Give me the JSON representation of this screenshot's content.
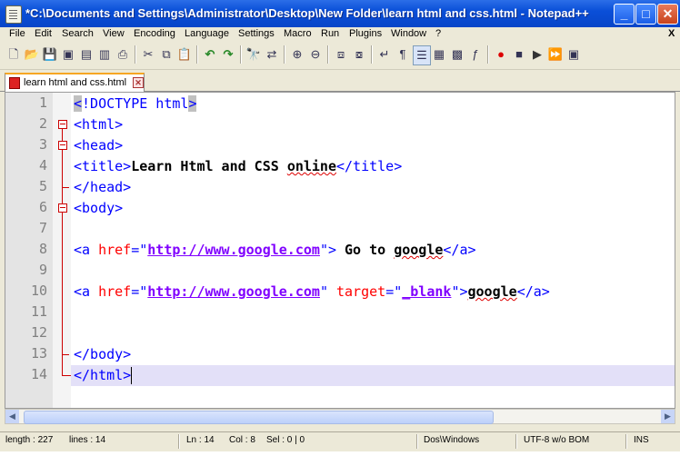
{
  "window": {
    "title": "*C:\\Documents and Settings\\Administrator\\Desktop\\New Folder\\learn html and css.html - Notepad++",
    "min_glyph": "_",
    "max_glyph": "□",
    "close_glyph": "✕"
  },
  "menu": [
    "File",
    "Edit",
    "Search",
    "View",
    "Encoding",
    "Language",
    "Settings",
    "Macro",
    "Run",
    "Plugins",
    "Window",
    "?"
  ],
  "menu_close": "X",
  "tab": {
    "label": "learn html and css.html",
    "close": "✕"
  },
  "line_numbers": [
    "1",
    "2",
    "3",
    "4",
    "5",
    "6",
    "7",
    "8",
    "9",
    "10",
    "11",
    "12",
    "13",
    "14"
  ],
  "code": {
    "l1": {
      "a": "<",
      "b": "!DOCTYPE html",
      "c": ">"
    },
    "l2": "<html>",
    "l3": "<head>",
    "l4": {
      "open": "<title>",
      "text": "Learn Html and CSS ",
      "word": "online",
      "close": "</title>"
    },
    "l5": "</head>",
    "l6": "<body>",
    "l8": {
      "open": "<a ",
      "attr": "href",
      "eq": "=\"",
      "url": "http://www.google.com",
      "q": "\">",
      "t1": " Go to ",
      "t2": "google",
      "close": "</a>"
    },
    "l10": {
      "open": "<a ",
      "attr": "href",
      "eq": "=\"",
      "url": "http://www.google.com",
      "q1": "\" ",
      "attr2": "target",
      "eq2": "=\"",
      "val": "_blank",
      "q2": "\">",
      "t": "google",
      "close": "</a>"
    },
    "l13": "</body>",
    "l14": "</html>"
  },
  "status": {
    "length": "length : 227",
    "lines": "lines : 14",
    "ln": "Ln : 14",
    "col": "Col : 8",
    "sel": "Sel : 0 | 0",
    "eol": "Dos\\Windows",
    "encoding": "UTF-8 w/o BOM",
    "mode": "INS"
  }
}
